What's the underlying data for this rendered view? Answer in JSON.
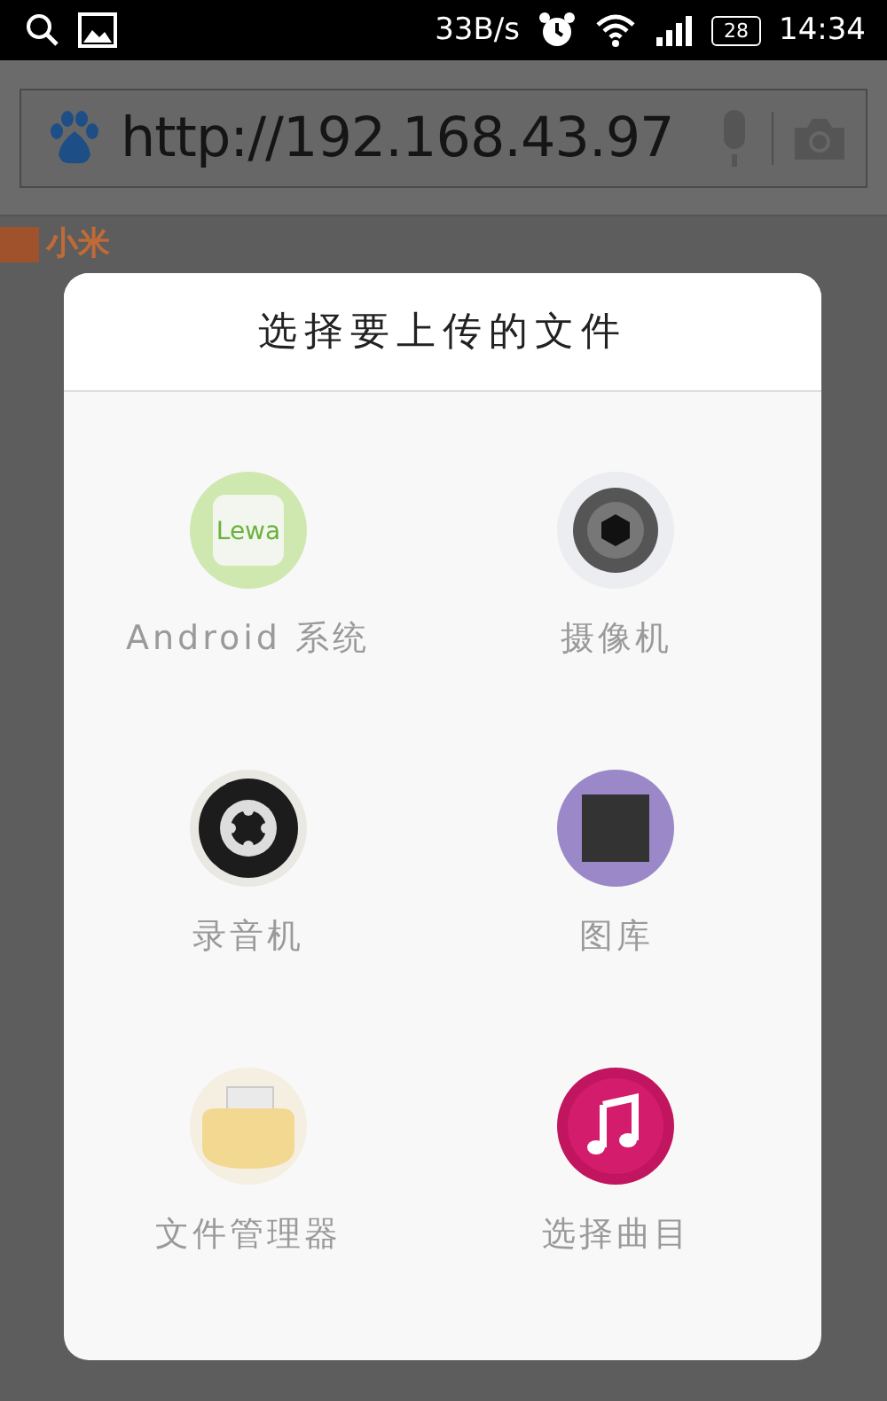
{
  "status_bar": {
    "speed": "33B/s",
    "battery": "28",
    "time": "14:34"
  },
  "browser": {
    "url": "http://192.168.43.97",
    "site_logo": "小米"
  },
  "dialog": {
    "title": "选择要上传的文件",
    "options": [
      {
        "kind": "lewa",
        "label": "Android 系统",
        "badge": "Lewa"
      },
      {
        "kind": "camera",
        "label": "摄像机"
      },
      {
        "kind": "recorder",
        "label": "录音机"
      },
      {
        "kind": "gallery",
        "label": "图库"
      },
      {
        "kind": "folder",
        "label": "文件管理器"
      },
      {
        "kind": "music",
        "label": "选择曲目"
      }
    ]
  }
}
